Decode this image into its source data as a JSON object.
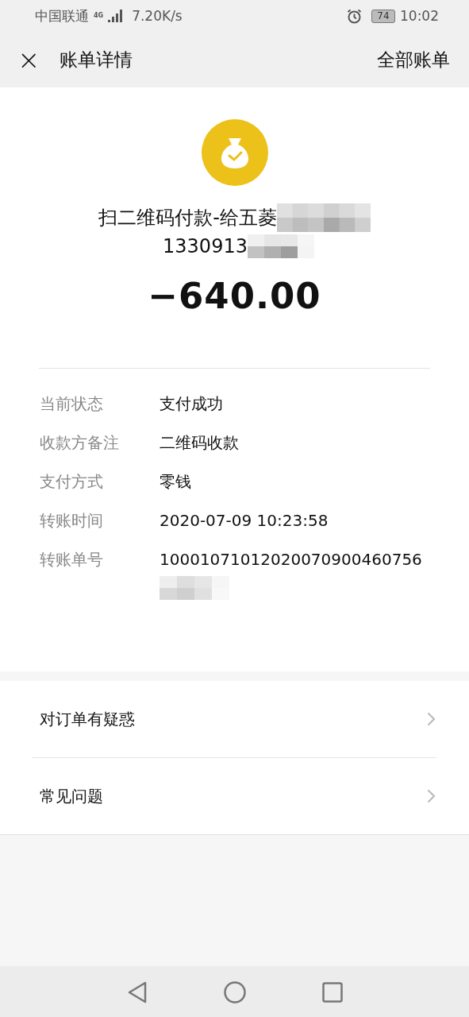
{
  "status_bar": {
    "carrier": "中国联通",
    "network_type": "4G",
    "network_speed": "7.20K/s",
    "battery": "74",
    "time": "10:02"
  },
  "header": {
    "close": "×",
    "title": "账单详情",
    "action": "全部账单"
  },
  "payment": {
    "title": "扫二维码付款-给五菱",
    "subtitle": "1330913",
    "amount": "−640.00"
  },
  "details": [
    {
      "label": "当前状态",
      "value": "支付成功"
    },
    {
      "label": "收款方备注",
      "value": "二维码收款"
    },
    {
      "label": "支付方式",
      "value": "零钱"
    },
    {
      "label": "转账时间",
      "value": "2020-07-09 10:23:58"
    },
    {
      "label": "转账单号",
      "value": "10001071012020070900460756",
      "redacted_tail": true
    }
  ],
  "links": [
    {
      "label": "对订单有疑惑"
    },
    {
      "label": "常见问题"
    }
  ]
}
